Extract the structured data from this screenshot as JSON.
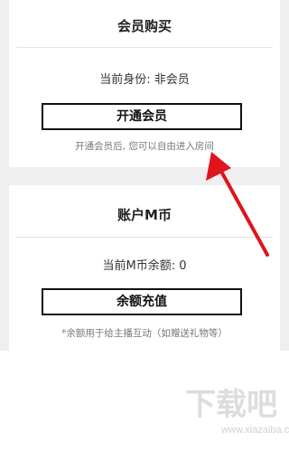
{
  "membership_card": {
    "title": "会员购买",
    "status": "当前身份: 非会员",
    "button_label": "开通会员",
    "hint": "开通会员后, 您可以自由进入房间"
  },
  "account_card": {
    "title": "账户M币",
    "status": "当前M币余额: 0",
    "button_label": "余额充值",
    "hint": "*余额用于给主播互动（如赠送礼物等）"
  },
  "watermark": {
    "logo": "下载吧",
    "url": "www.xiazaiba.com"
  },
  "colors": {
    "arrow": "#e0141b",
    "background_gray": "#efefef"
  }
}
